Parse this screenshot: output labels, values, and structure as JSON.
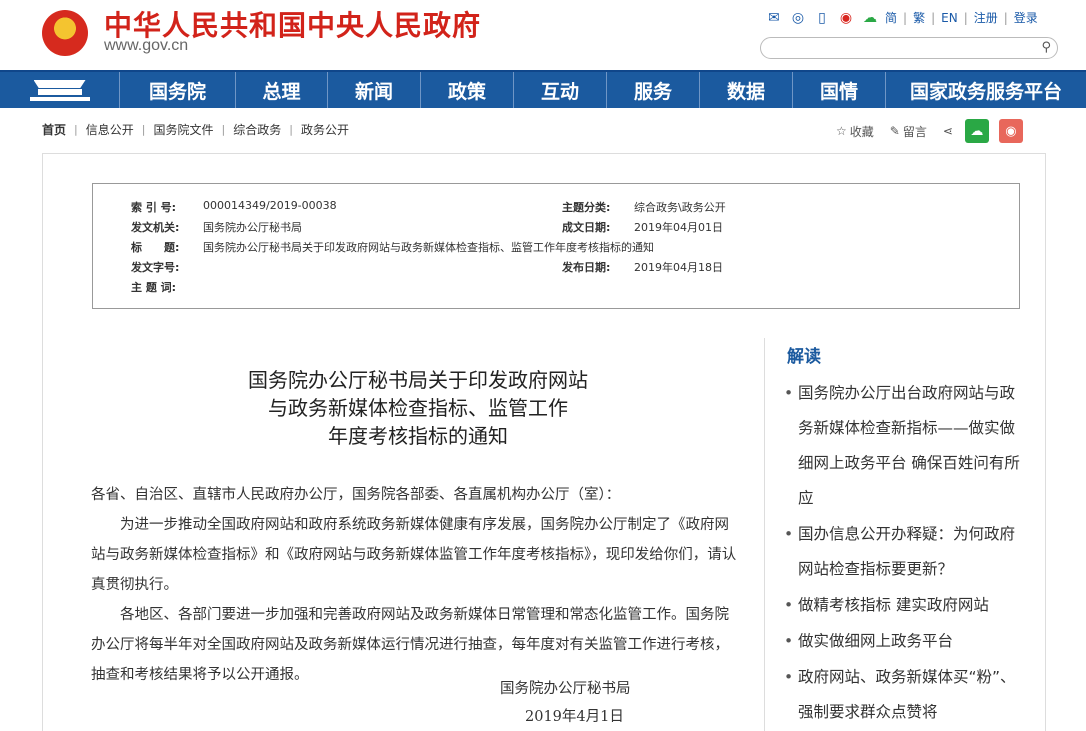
{
  "header": {
    "title": "中华人民共和国中央人民政府",
    "url": "www.gov.cn",
    "icons": [
      "mail-icon",
      "message-icon",
      "mobile-icon",
      "weibo-icon",
      "wechat-icon"
    ],
    "langs": [
      "简",
      "繁",
      "EN",
      "注册",
      "登录"
    ]
  },
  "nav": {
    "items": [
      "国务院",
      "总理",
      "新闻",
      "政策",
      "互动",
      "服务",
      "数据",
      "国情",
      "国家政务服务平台"
    ]
  },
  "breadcrumb": [
    "首页",
    "信息公开",
    "国务院文件",
    "综合政务",
    "政务公开"
  ],
  "share": {
    "favorite": "收藏",
    "comment": "留言"
  },
  "info": {
    "index_label": "索 引 号:",
    "index_val": "000014349/2019-00038",
    "category_label": "主题分类:",
    "category_val": "综合政务\\政务公开",
    "issuer_label": "发文机关:",
    "issuer_val": "国务院办公厅秘书局",
    "created_label": "成文日期:",
    "created_val": "2019年04月01日",
    "title_label": "标　　题:",
    "title_val": "国务院办公厅秘书局关于印发政府网站与政务新媒体检查指标、监管工作年度考核指标的通知",
    "docno_label": "发文字号:",
    "docno_val": "",
    "publish_label": "发布日期:",
    "publish_val": "2019年04月18日",
    "keywords_label": "主 题 词:",
    "keywords_val": ""
  },
  "article": {
    "title_line1": "国务院办公厅秘书局关于印发政府网站",
    "title_line2": "与政务新媒体检查指标、监管工作",
    "title_line3": "年度考核指标的通知",
    "greeting": "各省、自治区、直辖市人民政府办公厅，国务院各部委、各直属机构办公厅（室）：",
    "para1": "为进一步推动全国政府网站和政府系统政务新媒体健康有序发展，国务院办公厅制定了《政府网站与政务新媒体检查指标》和《政府网站与政务新媒体监管工作年度考核指标》，现印发给你们，请认真贯彻执行。",
    "para2": "各地区、各部门要进一步加强和完善政府网站及政务新媒体日常管理和常态化监管工作。国务院办公厅将每半年对全国政府网站及政务新媒体运行情况进行抽查，每年度对有关监管工作进行考核，抽查和考核结果将予以公开通报。",
    "signature": "国务院办公厅秘书局",
    "date": "2019年4月1日"
  },
  "sidebar": {
    "title": "解读",
    "items": [
      "国务院办公厅出台政府网站与政务新媒体检查新指标——做实做细网上政务平台 确保百姓问有所应",
      "国办信息公开办释疑：为何政府网站检查指标要更新？",
      "做精考核指标 建实政府网站",
      "做实做细网上政务平台",
      "政府网站、政务新媒体买“粉”、强制要求群众点赞将"
    ]
  }
}
